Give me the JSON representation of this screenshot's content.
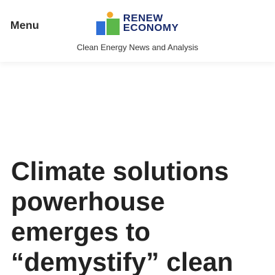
{
  "header": {
    "menu_label": "Menu",
    "logo": {
      "line1": "RENEW",
      "line2": "ECONOMY",
      "colors": {
        "blue_bar": "#2f6fd6",
        "green_block": "#5cb84a",
        "dot": "#f2a72b",
        "text": "#16296b"
      }
    },
    "tagline": "Clean Energy News and Analysis"
  },
  "article": {
    "headline": "Climate solutions powerhouse emerges to “demystify” clean"
  }
}
